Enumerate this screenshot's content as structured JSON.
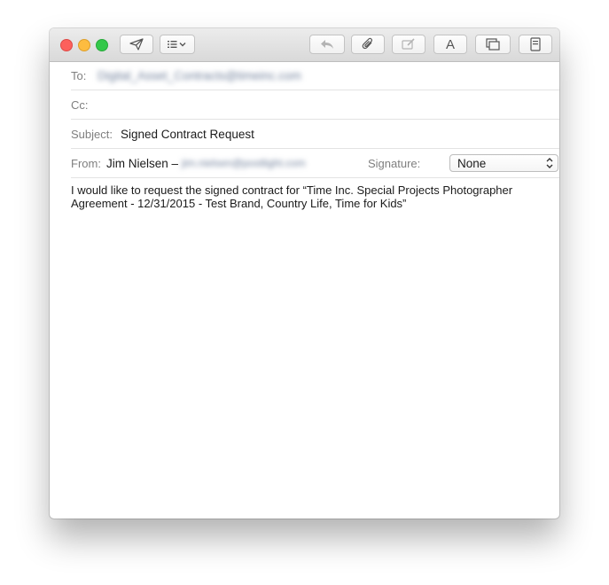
{
  "toolbar": {
    "buttons": [
      {
        "name": "send-icon"
      },
      {
        "name": "header-fields-icon"
      },
      {
        "name": "reply-icon"
      },
      {
        "name": "attachment-icon"
      },
      {
        "name": "markup-icon"
      },
      {
        "name": "format-icon",
        "glyph": "A"
      },
      {
        "name": "photo-browser-icon"
      },
      {
        "name": "stationery-icon"
      }
    ]
  },
  "header": {
    "to_label": "To:",
    "to_value": "Digital_Asset_Contracts@timeinc.com",
    "cc_label": "Cc:",
    "cc_value": "",
    "subject_label": "Subject:",
    "subject_value": "Signed Contract Request",
    "from_label": "From:",
    "from_name": "Jim Nielsen –",
    "from_email": "jim.nielsen@postlight.com",
    "signature_label": "Signature:",
    "signature_value": "None"
  },
  "message": {
    "body": "I would like to request the signed contract for “Time Inc. Special Projects Photographer Agreement - 12/31/2015 - Test Brand, Country Life, Time for Kids”"
  },
  "colors": {
    "close": "#fc605c",
    "minimize": "#fdbc40",
    "zoom": "#34c84a"
  }
}
